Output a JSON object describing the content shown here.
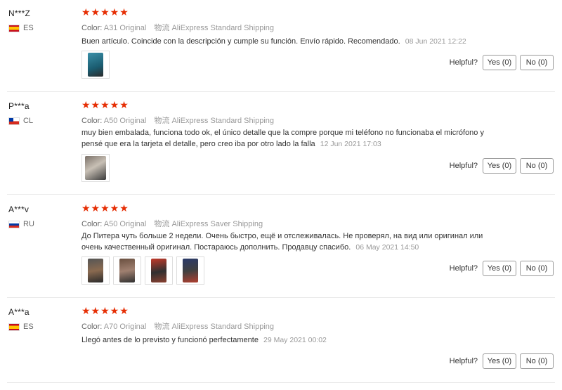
{
  "reviews": [
    {
      "user": "N***Z",
      "country": "ES",
      "stars": "★★★★★",
      "color_label": "Color:",
      "color": "A31 Original",
      "ship_label": "物流",
      "shipping": "AliExpress Standard Shipping",
      "text": "Buen artículo. Coincide con la descripción y cumple su función. Envío rápido. Recomendado.",
      "date": "08 Jun 2021 12:22",
      "images": 1,
      "helpful_label": "Helpful?",
      "yes": "Yes (0)",
      "no": "No (0)"
    },
    {
      "user": "P***a",
      "country": "CL",
      "stars": "★★★★★",
      "color_label": "Color:",
      "color": "A50 Original",
      "ship_label": "物流",
      "shipping": "AliExpress Standard Shipping",
      "text": "muy bien embalada, funciona todo ok, el único detalle que la compre porque mi teléfono no funcionaba el micrófono y pensé que era la tarjeta el detalle, pero creo iba por otro lado la falla",
      "date": "12 Jun 2021 17:03",
      "images": 1,
      "helpful_label": "Helpful?",
      "yes": "Yes (0)",
      "no": "No (0)"
    },
    {
      "user": "A***v",
      "country": "RU",
      "stars": "★★★★★",
      "color_label": "Color:",
      "color": "A50 Original",
      "ship_label": "物流",
      "shipping": "AliExpress Saver Shipping",
      "text": "До Питера чуть больше 2 недели. Очень быстро, ещё и отслеживалась. Не проверял, на вид или оригинал или очень качественный оригинал. Постараюсь дополнить. Продавцу спасибо.",
      "date": "06 May 2021 14:50",
      "images": 4,
      "helpful_label": "Helpful?",
      "yes": "Yes (0)",
      "no": "No (0)"
    },
    {
      "user": "A***a",
      "country": "ES",
      "stars": "★★★★★",
      "color_label": "Color:",
      "color": "A70 Original",
      "ship_label": "物流",
      "shipping": "AliExpress Standard Shipping",
      "text": "Llegó antes de lo previsto y funcionó perfectamente",
      "date": "29 May 2021 00:02",
      "images": 0,
      "helpful_label": "Helpful?",
      "yes": "Yes (0)",
      "no": "No (0)"
    }
  ],
  "colors": {
    "star": "#e62e04",
    "muted": "#999999"
  }
}
